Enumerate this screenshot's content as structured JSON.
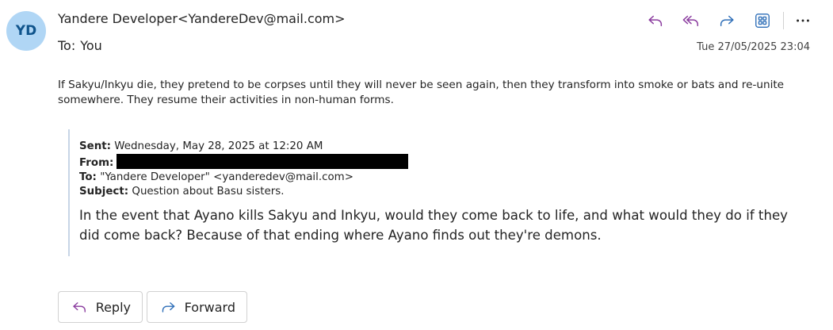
{
  "header": {
    "avatar_initials": "YD",
    "sender": "Yandere Developer<YandereDev@mail.com>",
    "to_label": "To:",
    "to_value": "You",
    "date": "Tue 27/05/2025 23:04"
  },
  "toolbar": {
    "icons": [
      "reply-icon",
      "reply-all-icon",
      "forward-icon",
      "apps-icon",
      "more-icon"
    ]
  },
  "message": {
    "body": "If Sakyu/Inkyu die, they pretend to be corpses until they will never be seen again, then they transform into smoke or bats and re-unite somewhere. They resume their activities in non-human forms."
  },
  "quoted": {
    "sent_label": "Sent:",
    "sent_value": "Wednesday, May 28, 2025 at 12:20 AM",
    "from_label": "From:",
    "to_label": "To:",
    "to_value": "\"Yandere Developer\" <yanderedev@mail.com>",
    "subject_label": "Subject:",
    "subject_value": "Question about Basu sisters.",
    "body": "In the event that Ayano kills Sakyu and Inkyu, would they come back to life, and what would they do if they did come back? Because of that ending where Ayano finds out they're demons."
  },
  "footer": {
    "reply_label": "Reply",
    "forward_label": "Forward"
  },
  "colors": {
    "accent_purple": "#8a3b9e",
    "accent_blue": "#2f6fb8",
    "avatar_bg": "#b0d6f5",
    "avatar_fg": "#0f548c"
  }
}
